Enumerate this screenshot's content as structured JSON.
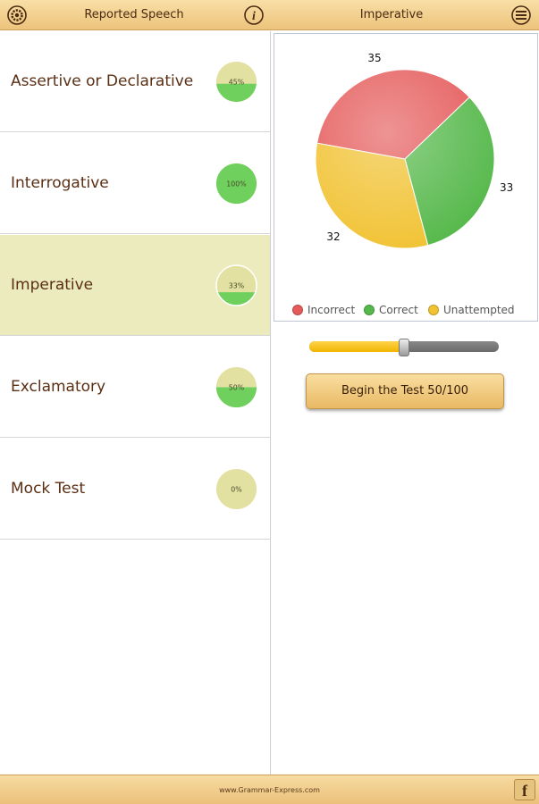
{
  "header": {
    "left_title": "Reported Speech",
    "right_title": "Imperative",
    "icons": [
      "gear-icon",
      "info-icon",
      "menu-icon"
    ]
  },
  "topics": [
    {
      "label": "Assertive or Declarative",
      "progress_label": "45%",
      "progress": 0.45,
      "selected": false
    },
    {
      "label": "Interrogative",
      "progress_label": "100%",
      "progress": 1.0,
      "selected": false
    },
    {
      "label": "Imperative",
      "progress_label": "33%",
      "progress": 0.33,
      "selected": true
    },
    {
      "label": "Exclamatory",
      "progress_label": "50%",
      "progress": 0.5,
      "selected": false
    },
    {
      "label": "Mock Test",
      "progress_label": "0%",
      "progress": 0.0,
      "selected": false
    }
  ],
  "chart_data": {
    "type": "pie",
    "title": "",
    "slices": [
      {
        "name": "Incorrect",
        "value": 35,
        "color": "#e55a5a"
      },
      {
        "name": "Correct",
        "value": 33,
        "color": "#55b84a"
      },
      {
        "name": "Unattempted",
        "value": 32,
        "color": "#f1c232"
      }
    ],
    "legend_position": "bottom"
  },
  "slider": {
    "value": 50,
    "max": 100
  },
  "begin_button": {
    "label": "Begin the Test 50/100"
  },
  "footer": {
    "url": "www.Grammar-Express.com",
    "facebook_label": "f"
  },
  "colors": {
    "bar": "#f0c988",
    "selected_row": "#ecebbe",
    "progress_track": "#e2e1a2",
    "progress_fill": "#6fd05e"
  }
}
